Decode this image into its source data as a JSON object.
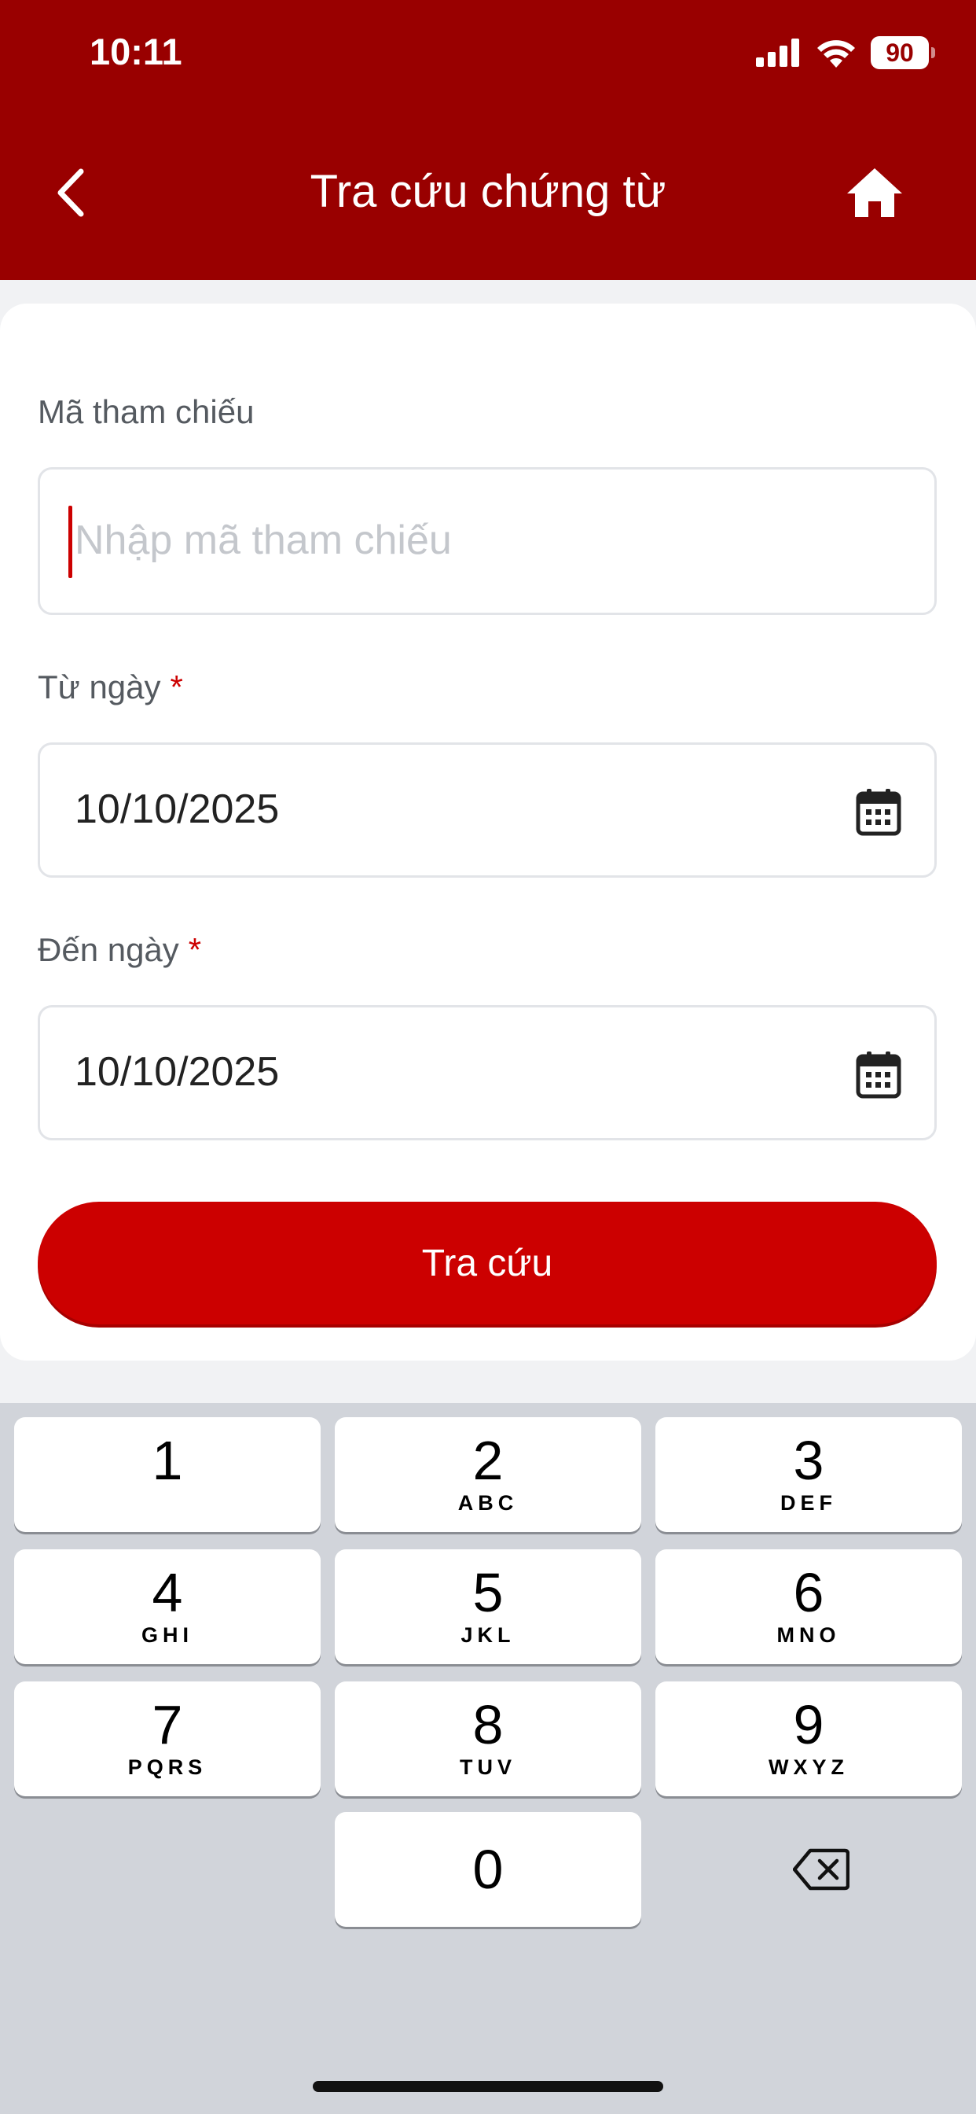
{
  "status_bar": {
    "time": "10:11",
    "battery": "90"
  },
  "header": {
    "title": "Tra cứu chứng từ"
  },
  "form": {
    "reference": {
      "label": "Mã tham chiếu",
      "placeholder": "Nhập mã tham chiếu",
      "value": ""
    },
    "from_date": {
      "label": "Từ ngày",
      "required_mark": "*",
      "value": "10/10/2025"
    },
    "to_date": {
      "label": "Đến ngày",
      "required_mark": "*",
      "value": "10/10/2025"
    },
    "submit_label": "Tra cứu"
  },
  "keyboard": {
    "keys": [
      {
        "digit": "1",
        "letters": ""
      },
      {
        "digit": "2",
        "letters": "ABC"
      },
      {
        "digit": "3",
        "letters": "DEF"
      },
      {
        "digit": "4",
        "letters": "GHI"
      },
      {
        "digit": "5",
        "letters": "JKL"
      },
      {
        "digit": "6",
        "letters": "MNO"
      },
      {
        "digit": "7",
        "letters": "PQRS"
      },
      {
        "digit": "8",
        "letters": "TUV"
      },
      {
        "digit": "9",
        "letters": "WXYZ"
      },
      {
        "digit": "0",
        "letters": ""
      }
    ]
  },
  "colors": {
    "header": "#990000",
    "accent": "#cc0000",
    "keyboard_bg": "#d1d4da"
  }
}
